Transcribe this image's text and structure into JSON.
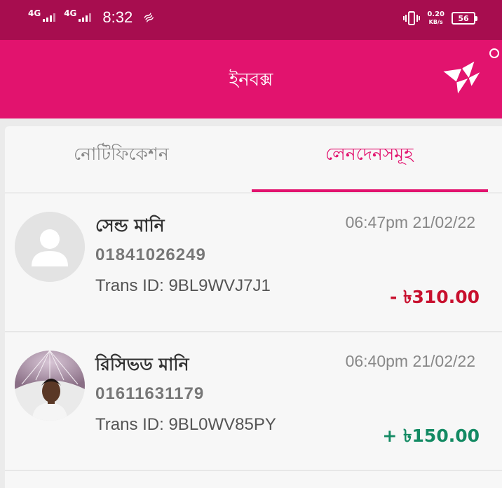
{
  "status_bar": {
    "network1": "4G",
    "network2": "4G",
    "time": "8:32",
    "speed_value": "0.20",
    "speed_unit": "KB/s",
    "battery": "56"
  },
  "header": {
    "title": "ইনবক্স"
  },
  "tabs": [
    {
      "label": "নোটিফিকেশন",
      "active": false
    },
    {
      "label": "লেনদেনসমূহ",
      "active": true
    }
  ],
  "transactions": [
    {
      "title": "সেন্ড মানি",
      "phone": "01841026249",
      "trans_id": "Trans ID: 9BL9WVJ7J1",
      "datetime": "06:47pm 21/02/22",
      "amount": "- ৳310.00",
      "type": "debit"
    },
    {
      "title": "রিসিভড মানি",
      "phone": "01611631179",
      "trans_id": "Trans ID: 9BL0WV85PY",
      "datetime": "06:40pm 21/02/22",
      "amount": "+ ৳150.00",
      "type": "credit"
    }
  ],
  "colors": {
    "status_bar": "#a70d4f",
    "brand": "#e2136e",
    "debit": "#c8102e",
    "credit": "#138a63"
  }
}
